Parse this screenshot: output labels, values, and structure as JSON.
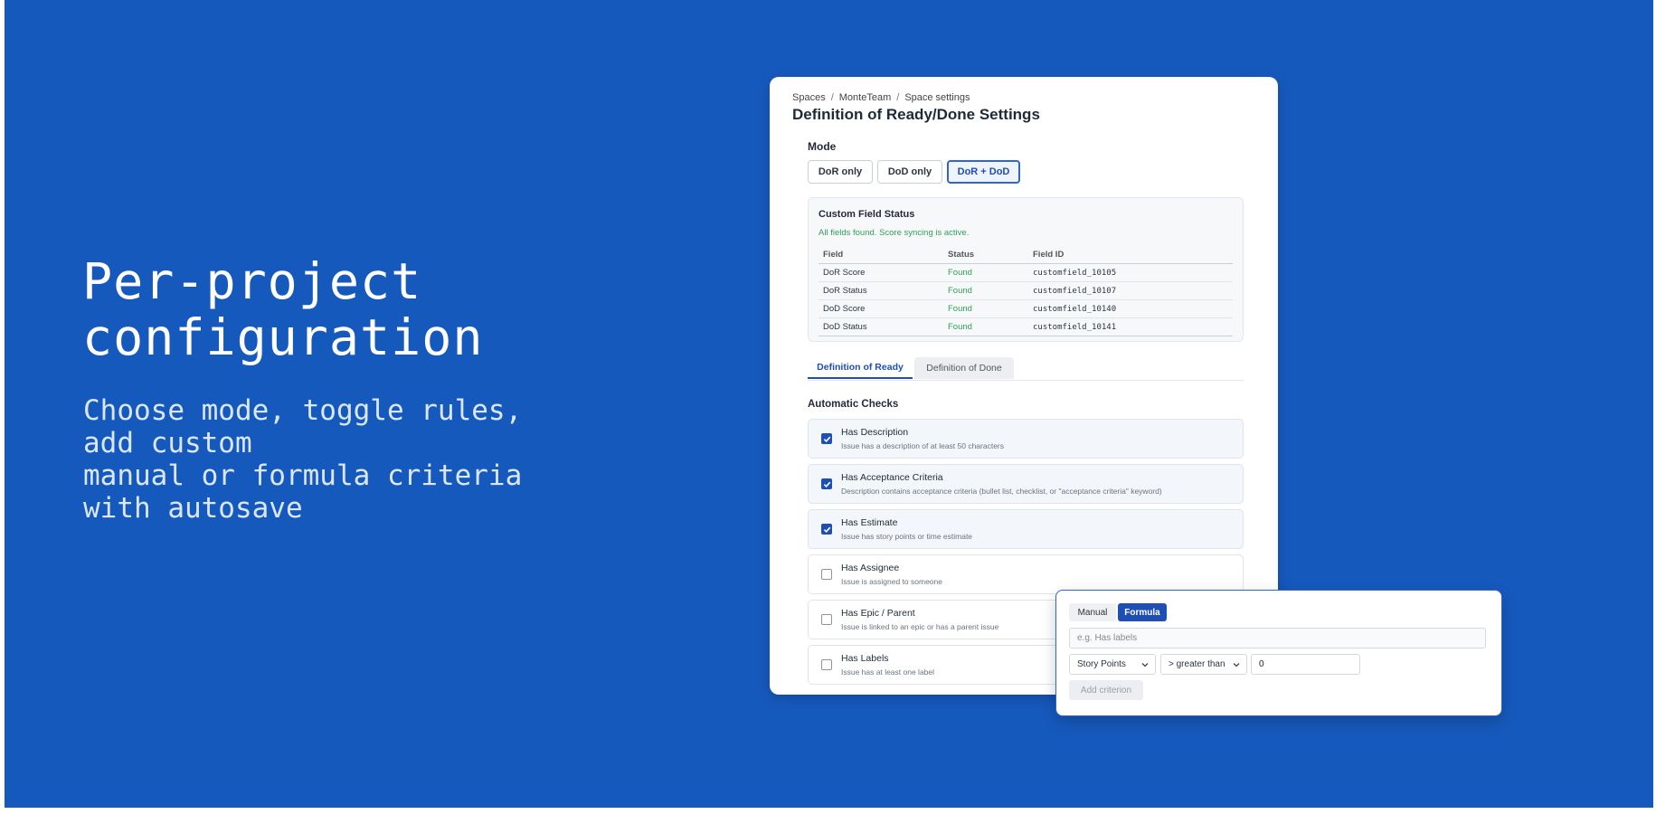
{
  "hero": {
    "title_line1": "Per-project",
    "title_line2": "configuration",
    "subtitle": "Choose mode, toggle rules,\nadd custom\nmanual or formula criteria\nwith autosave"
  },
  "breadcrumb": [
    "Spaces",
    "MonteTeam",
    "Space settings"
  ],
  "page_title": "Definition of Ready/Done Settings",
  "mode": {
    "label": "Mode",
    "options": [
      "DoR only",
      "DoD only",
      "DoR + DoD"
    ],
    "selected": "DoR + DoD"
  },
  "custom_field_status": {
    "title": "Custom Field Status",
    "message": "All fields found. Score syncing is active.",
    "columns": [
      "Field",
      "Status",
      "Field ID"
    ],
    "rows": [
      [
        "DoR Score",
        "Found",
        "customfield_10105"
      ],
      [
        "DoR Status",
        "Found",
        "customfield_10107"
      ],
      [
        "DoD Score",
        "Found",
        "customfield_10140"
      ],
      [
        "DoD Status",
        "Found",
        "customfield_10141"
      ]
    ]
  },
  "tabs": [
    "Definition of Ready",
    "Definition of Done"
  ],
  "automatic_checks": {
    "label": "Automatic Checks",
    "items": [
      {
        "title": "Has Description",
        "desc": "Issue has a description of at least 50 characters",
        "checked": true
      },
      {
        "title": "Has Acceptance Criteria",
        "desc": "Description contains acceptance criteria (bullet list, checklist, or \"acceptance criteria\" keyword)",
        "checked": true
      },
      {
        "title": "Has Estimate",
        "desc": "Issue has story points or time estimate",
        "checked": true
      },
      {
        "title": "Has Assignee",
        "desc": "Issue is assigned to someone",
        "checked": false
      },
      {
        "title": "Has Epic / Parent",
        "desc": "Issue is linked to an epic or has a parent issue",
        "checked": false
      },
      {
        "title": "Has Labels",
        "desc": "Issue has at least one label",
        "checked": false
      }
    ]
  },
  "criterion_popup": {
    "mode_options": [
      "Manual",
      "Formula"
    ],
    "selected_mode": "Formula",
    "name_placeholder": "e.g. Has labels",
    "field_select": "Story Points",
    "operator_select": "> greater than",
    "value": "0",
    "add_label": "Add criterion"
  },
  "colors": {
    "background": "#1659bd",
    "accent": "#1d4fb5",
    "success": "#2e9f57"
  }
}
